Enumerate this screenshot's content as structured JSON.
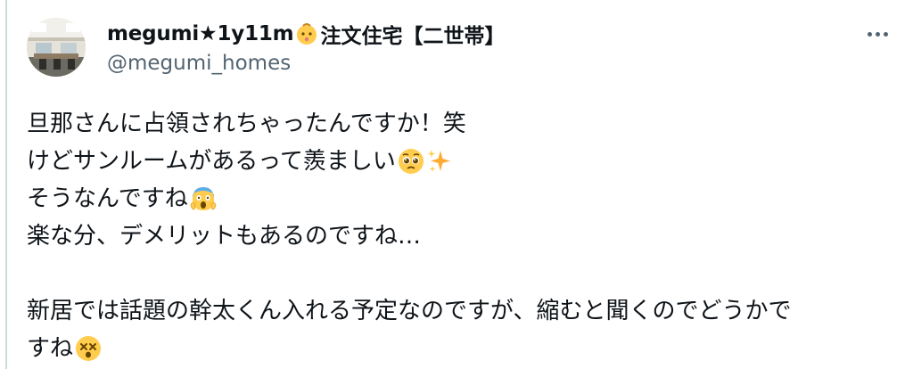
{
  "author": {
    "display_name": "megumi★1y11m",
    "name_emoji": "baby-face-icon",
    "name_suffix": "注文住宅【二世帯】",
    "handle": "@megumi_homes"
  },
  "tweet": {
    "lines": [
      {
        "text": "旦那さんに占領されちゃったんですか！笑",
        "emoji": []
      },
      {
        "text": "けどサンルームがあるって羨ましい",
        "emoji": [
          "pleading-face-icon",
          "sparkles-icon"
        ]
      },
      {
        "text": "そうなんですね",
        "emoji": [
          "screaming-face-icon"
        ]
      },
      {
        "text": "楽な分、デメリットもあるのですね…",
        "emoji": []
      },
      {
        "text": "",
        "emoji": []
      },
      {
        "text": "新居では話題の幹太くん入れる予定なのですが、縮むと聞くのでどうかで",
        "emoji": []
      },
      {
        "text": "すね",
        "emoji": [
          "dizzy-face-icon"
        ]
      }
    ]
  },
  "colors": {
    "text": "#0f1419",
    "secondary": "#536471",
    "thread_line": "#cfd9de",
    "emoji_yellow": "#ffcc4d"
  }
}
